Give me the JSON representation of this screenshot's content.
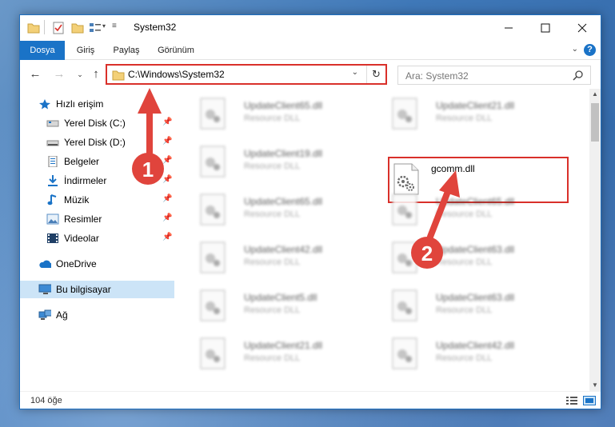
{
  "window": {
    "title": "System32"
  },
  "ribbon": {
    "tabs": [
      {
        "label": "Dosya"
      },
      {
        "label": "Giriş"
      },
      {
        "label": "Paylaş"
      },
      {
        "label": "Görünüm"
      }
    ],
    "help_label": "?"
  },
  "address": {
    "path": "C:\\Windows\\System32"
  },
  "search": {
    "placeholder": "Ara: System32"
  },
  "sidebar": {
    "items": [
      {
        "label": "Hızlı erişim"
      },
      {
        "label": "Yerel Disk (C:)"
      },
      {
        "label": "Yerel Disk (D:)"
      },
      {
        "label": "Belgeler"
      },
      {
        "label": "İndirmeler"
      },
      {
        "label": "Müzik"
      },
      {
        "label": "Resimler"
      },
      {
        "label": "Videolar"
      },
      {
        "label": "OneDrive"
      },
      {
        "label": "Bu bilgisayar"
      },
      {
        "label": "Ağ"
      }
    ]
  },
  "files": {
    "left": [
      {
        "name": "UpdateClient65.dll",
        "type": "Resource DLL"
      },
      {
        "name": "UpdateClient19.dll",
        "type": "Resource DLL"
      },
      {
        "name": "UpdateClient65.dll",
        "type": "Resource DLL"
      },
      {
        "name": "UpdateClient42.dll",
        "type": "Resource DLL"
      },
      {
        "name": "UpdateClient5.dll",
        "type": "Resource DLL"
      },
      {
        "name": "UpdateClient21.dll",
        "type": "Resource DLL"
      }
    ],
    "right": [
      {
        "name": "UpdateClient21.dll",
        "type": "Resource DLL"
      },
      {
        "name": "gcomm.dll",
        "type": ""
      },
      {
        "name": "UpdateClient65.dll",
        "type": "Resource DLL"
      },
      {
        "name": "UpdateClient63.dll",
        "type": "Resource DLL"
      },
      {
        "name": "UpdateClient63.dll",
        "type": "Resource DLL"
      },
      {
        "name": "UpdateClient42.dll",
        "type": "Resource DLL"
      }
    ]
  },
  "status": {
    "item_count": "104 öğe"
  },
  "annotations": {
    "step1": "1",
    "step2": "2"
  },
  "colors": {
    "accent": "#1a73c7",
    "highlight": "#d9302a",
    "selected": "#cce4f7"
  }
}
